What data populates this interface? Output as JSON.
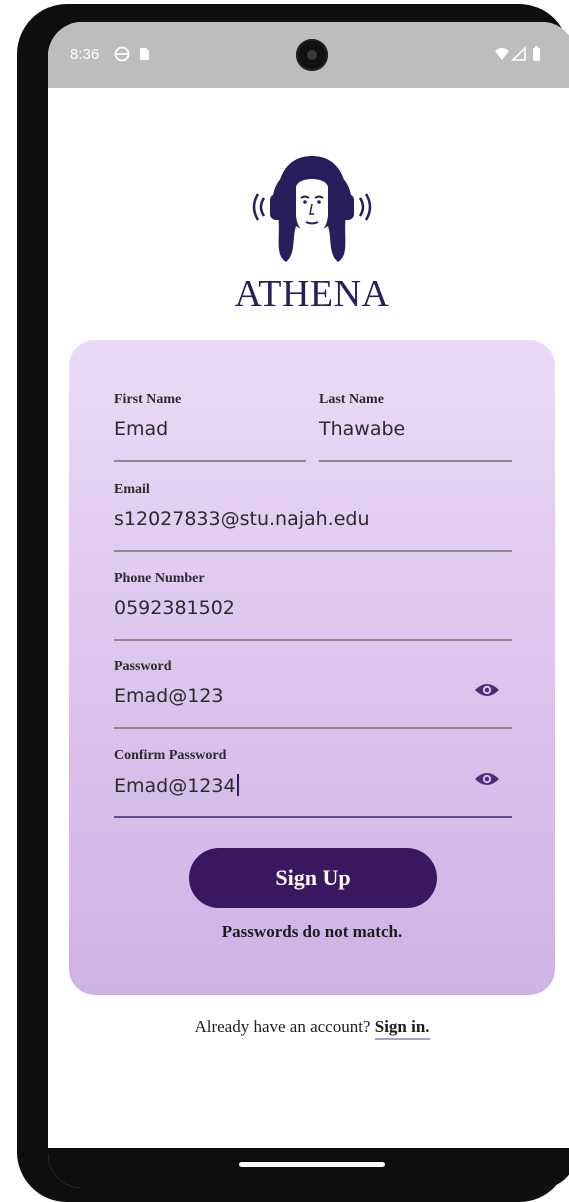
{
  "status_bar": {
    "time": "8:36",
    "left_icons": [
      "vpn-icon",
      "sim-card-icon"
    ],
    "right_icons": [
      "wifi-icon",
      "signal-icon",
      "battery-icon"
    ]
  },
  "brand": {
    "name": "ATHENA",
    "logo_icon": "athena-headphones-icon"
  },
  "form": {
    "first_name": {
      "label": "First Name",
      "value": "Emad"
    },
    "last_name": {
      "label": "Last Name",
      "value": "Thawabe"
    },
    "email": {
      "label": "Email",
      "value": "s12027833@stu.najah.edu"
    },
    "phone": {
      "label": "Phone Number",
      "value": "0592381502"
    },
    "password": {
      "label": "Password",
      "value": "Emad@123",
      "toggle_icon": "eye-icon"
    },
    "confirm_password": {
      "label": "Confirm Password",
      "value": "Emad@1234",
      "toggle_icon": "eye-icon"
    },
    "submit_label": "Sign Up",
    "error_message": "Passwords do not match."
  },
  "footer": {
    "prompt": "Already have an account?",
    "link_label": "Sign in."
  },
  "colors": {
    "brand": "#2a1d5c",
    "button": "#3b1760",
    "card_top": "#ebdaf7",
    "card_bottom": "#cdb3e5"
  }
}
